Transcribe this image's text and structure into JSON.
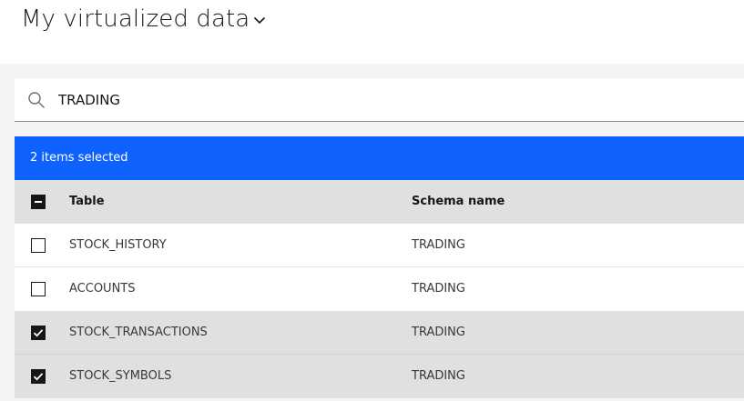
{
  "header": {
    "title": "My virtualized data"
  },
  "search": {
    "value": "TRADING"
  },
  "batch": {
    "label": "2 items selected"
  },
  "table": {
    "columns": [
      "Table",
      "Schema name"
    ],
    "rows": [
      {
        "table": "STOCK_HISTORY",
        "schema": "TRADING",
        "selected": false
      },
      {
        "table": "ACCOUNTS",
        "schema": "TRADING",
        "selected": false
      },
      {
        "table": "STOCK_TRANSACTIONS",
        "schema": "TRADING",
        "selected": true
      },
      {
        "table": "STOCK_SYMBOLS",
        "schema": "TRADING",
        "selected": true
      }
    ]
  },
  "icons": {
    "title_dropdown": "chevron-down-icon",
    "search": "search-icon",
    "select_all": "checkbox-indeterminate-icon",
    "row_checked": "checkmark-icon"
  },
  "colors": {
    "accent": "#0f62fe",
    "selected_row": "#e0e0e0",
    "page_background": "#f4f4f4"
  }
}
